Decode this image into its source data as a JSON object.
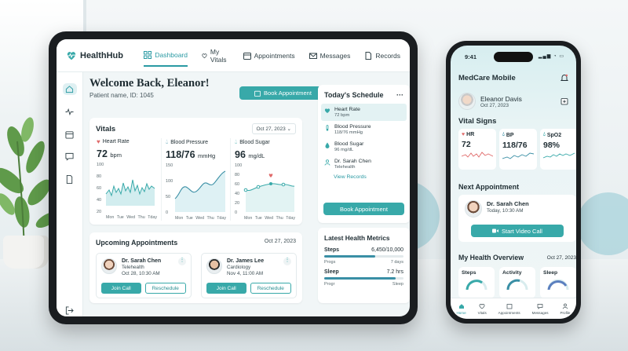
{
  "tablet": {
    "app_name": "HealthHub",
    "nav": [
      {
        "label": "Dashboard",
        "icon": "dashboard-icon"
      },
      {
        "label": "My Vitals",
        "icon": "heart-icon"
      },
      {
        "label": "Appointments",
        "icon": "calendar-icon"
      },
      {
        "label": "Messages",
        "icon": "mail-icon"
      },
      {
        "label": "Records",
        "icon": "document-icon"
      }
    ],
    "sidebar_icons": [
      "home-icon",
      "pulse-icon",
      "calendar-icon",
      "chat-icon",
      "file-icon",
      "logout-icon"
    ],
    "welcome": "Welcome Back, Eleanor!",
    "patient_id": "Patient name, ID: 1045",
    "book_label": "Book Appointment",
    "vitals": {
      "title": "Vitals",
      "date": "Oct 27, 2023",
      "days": [
        "Mon",
        "Tue",
        "Wed",
        "Thu",
        "Tday"
      ],
      "heart_rate": {
        "label": "Heart Rate",
        "value": "72",
        "unit": "bpm",
        "y_ticks": [
          "100",
          "80",
          "60",
          "40",
          "20"
        ]
      },
      "blood_pressure": {
        "label": "Blood Pressure",
        "value": "118/76",
        "unit": "mmHg",
        "y_ticks": [
          "150",
          "100",
          "50",
          "0"
        ]
      },
      "blood_sugar": {
        "label": "Blood Sugar",
        "value": "96",
        "unit": "mg/dL",
        "y_ticks": [
          "100",
          "80",
          "60",
          "40",
          "20",
          "0"
        ]
      }
    },
    "upcoming": {
      "title": "Upcoming Appointments",
      "date": "Oct 27, 2023",
      "items": [
        {
          "name": "Dr. Sarah Chen",
          "type": "Telehealth",
          "when": "Oct 28, 10:30 AM",
          "primary": "Join Call",
          "secondary": "Reschedule"
        },
        {
          "name": "Dr. James Lee",
          "type": "Cardiology",
          "when": "Nov 4, 11:00 AM",
          "primary": "Join Call",
          "secondary": "Reschedule"
        }
      ]
    },
    "schedule": {
      "title": "Today's Schedule",
      "more": "···",
      "items": [
        {
          "title": "Heart Rate",
          "sub": "72 bpm"
        },
        {
          "title": "Blood Pressure",
          "sub": "118/76 mmHg"
        },
        {
          "title": "Blood Sugar",
          "sub": "96 mg/dL"
        },
        {
          "title": "Dr. Sarah Chen",
          "sub": "Telehealth"
        }
      ],
      "view": "View Records",
      "book": "Book Appointment"
    },
    "metrics": {
      "title": "Latest Health Metrics",
      "items": [
        {
          "label": "Steps",
          "value": "6,450/10,000",
          "left": "Progs",
          "right": "7 days",
          "fraction": 0.64
        },
        {
          "label": "Sleep",
          "value": "7.2 hrs",
          "left": "Progr",
          "right": "Sleep",
          "fraction": 0.9
        }
      ]
    }
  },
  "phone": {
    "time": "9:41",
    "app_name": "MedCare Mobile",
    "user": {
      "name": "Eleanor Davis",
      "date": "Oct 27, 2023"
    },
    "vitals_title": "Vital Signs",
    "vitals": [
      {
        "label": "HR",
        "value": "72",
        "color": "#e06b6b"
      },
      {
        "label": "BP",
        "value": "118/76",
        "color": "#3a8fa5"
      },
      {
        "label": "SpO2",
        "value": "98%",
        "color": "#38a9a9"
      }
    ],
    "next_title": "Next Appointment",
    "next": {
      "name": "Dr. Sarah Chen",
      "when": "Today, 10:30 AM",
      "button": "Start Video Call"
    },
    "overview_title": "My Health Overview",
    "overview_date": "Oct 27, 2023",
    "overview": [
      "Steps",
      "Activity",
      "Sleep"
    ],
    "tabs": [
      "Home",
      "Vitals",
      "Appointments",
      "Messages",
      "Profile"
    ]
  },
  "colors": {
    "accent": "#38a9a9",
    "heart": "#e06b6b"
  }
}
